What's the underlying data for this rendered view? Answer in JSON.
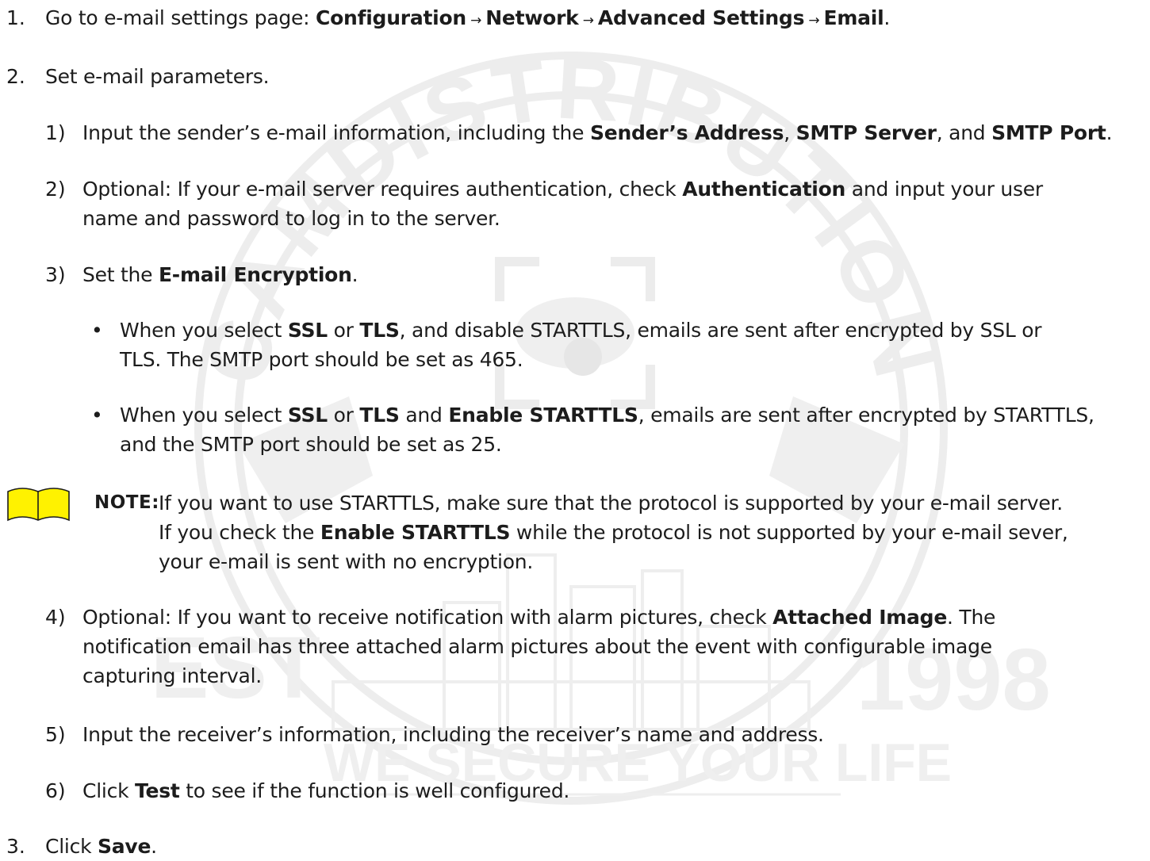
{
  "watermark": {
    "arc_text": "CAMDISTRIBUTION INC",
    "left_year": "EST",
    "right_year": "1998",
    "slogan": "WE SECURE YOUR LIFE",
    "color": "#e9e9e9"
  },
  "step1": {
    "number": "1.",
    "text": "Go to e-mail settings page: ",
    "path": [
      "Configuration",
      "Network",
      "Advanced Settings",
      "Email"
    ],
    "arrow": " → ",
    "end": "."
  },
  "step2": {
    "number": "2.",
    "text": "Set e-mail parameters."
  },
  "sub1": {
    "number": "1)",
    "pre": "Input the sender’s e-mail information, including the ",
    "b1": "Sender’s Address",
    "mid1": ", ",
    "b2": "SMTP Server",
    "mid2": ", and ",
    "b3": "SMTP Port",
    "end": "."
  },
  "sub2": {
    "number": "2)",
    "line1_pre": "Optional: If your e-mail server requires authentication, check ",
    "line1_bold": "Authentication",
    "line1_post": " and input your user",
    "line2": "name and password to log in to the server."
  },
  "sub3": {
    "number": "3)",
    "pre": "Set the ",
    "bold": "E-mail Encryption",
    "end": "."
  },
  "bullet1": {
    "marker": "•",
    "line1_pre": "When you select ",
    "b1": "SSL",
    "or": " or ",
    "b2": "TLS",
    "line1_post": ", and disable STARTTLS, emails are sent after encrypted by SSL or",
    "line2": "TLS. The SMTP port should be set as 465."
  },
  "bullet2": {
    "marker": "•",
    "line1_pre": "When you select ",
    "b1": "SSL",
    "or": " or ",
    "b2": "TLS",
    "and": " and ",
    "b3": "Enable STARTTLS",
    "line1_post": ", emails are sent after encrypted by STARTTLS,",
    "line2": "and the SMTP port should be set as 25."
  },
  "note": {
    "label": "NOTE:",
    "line1": "If you want to use STARTTLS, make sure that the protocol is supported by your e-mail server.",
    "line2_pre": "If you check the ",
    "line2_bold": "Enable STARTTLS",
    "line2_post": " while the protocol is not supported by your e-mail sever,",
    "line3": "your e-mail is sent with no encryption.",
    "icon_color": "#fff200"
  },
  "sub4": {
    "number": "4)",
    "line1_pre": "Optional: If you want to receive notification with alarm pictures, check ",
    "line1_bold": "Attached Image",
    "line1_post": ". The",
    "line2": "notification email has three attached alarm pictures about the event with configurable image",
    "line3": "capturing interval."
  },
  "sub5": {
    "number": "5)",
    "text": "Input the receiver’s information, including the receiver’s name and address."
  },
  "sub6": {
    "number": "6)",
    "pre": "Click ",
    "bold": "Test",
    "post": " to see if the function is well configured."
  },
  "step3": {
    "number": "3.",
    "pre": "Click ",
    "bold": "Save",
    "end": "."
  }
}
